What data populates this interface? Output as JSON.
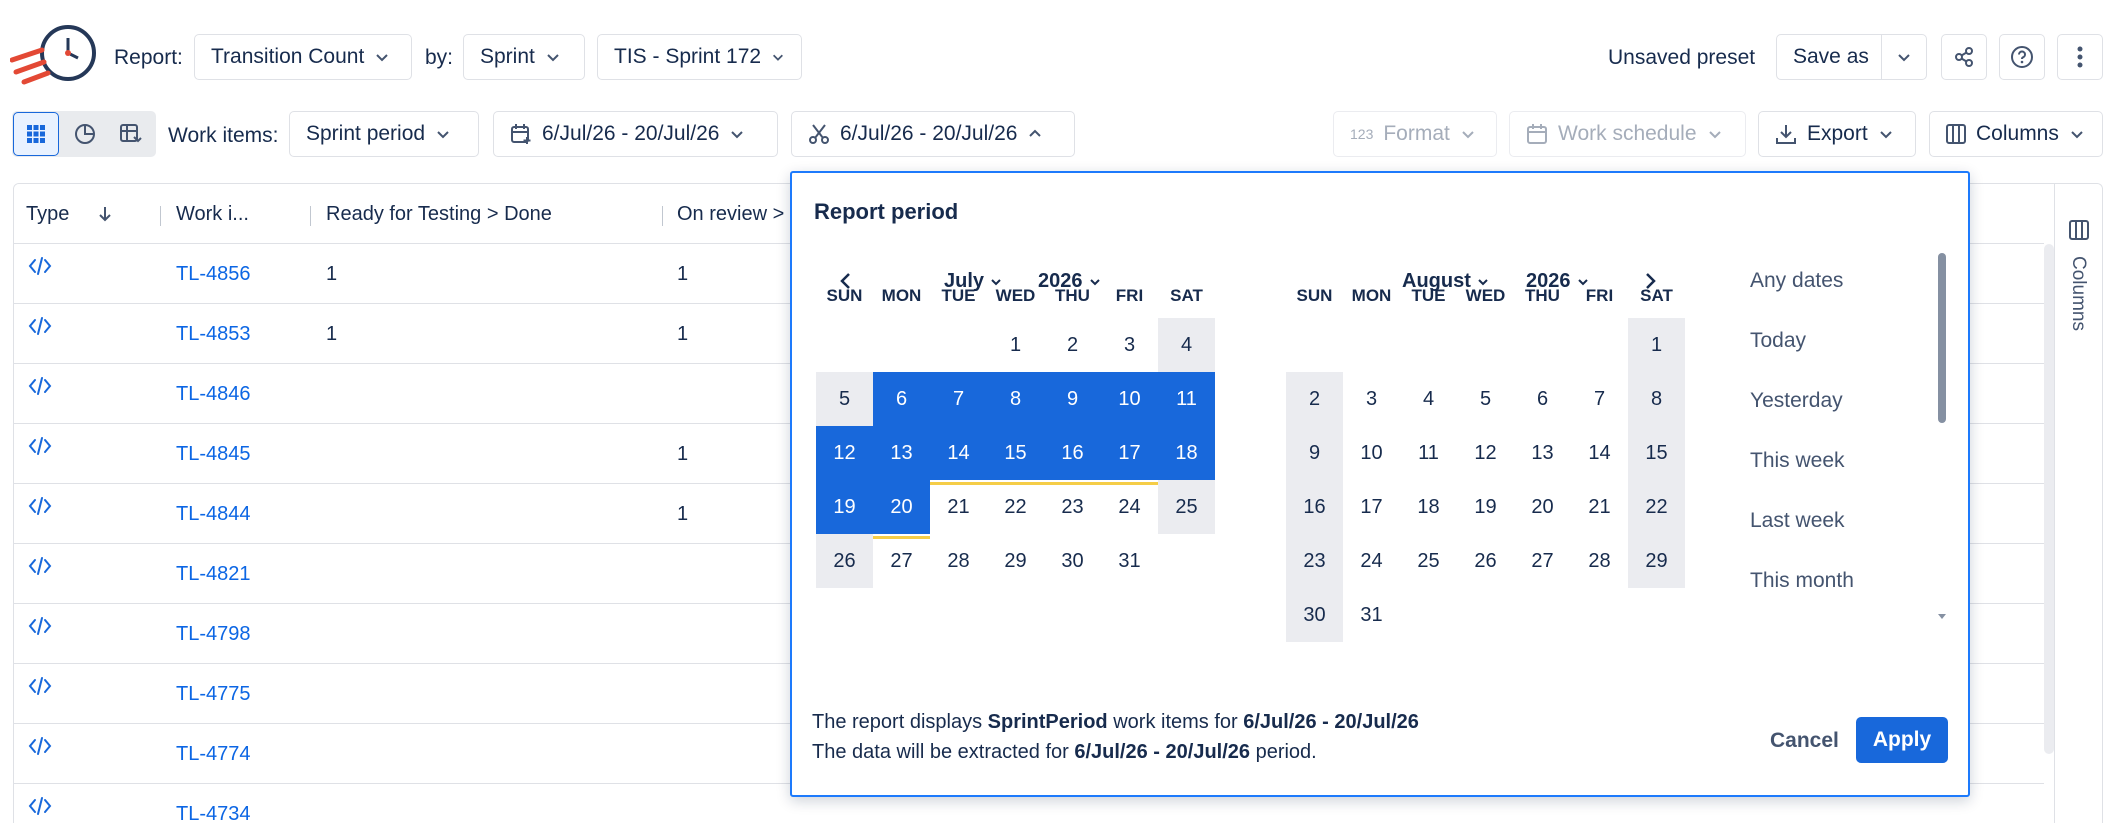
{
  "toolbar1": {
    "report_label": "Report:",
    "report_value": "Transition Count",
    "by_label": "by:",
    "by_value": "Sprint",
    "sprint_value": "TIS - Sprint 172",
    "preset_status": "Unsaved preset",
    "save_as": "Save as"
  },
  "toolbar2": {
    "work_items_label": "Work items:",
    "work_items_value": "Sprint period",
    "date_range_1": "6/Jul/26 - 20/Jul/26",
    "date_range_2": "6/Jul/26 - 20/Jul/26",
    "format": "Format",
    "format_prefix": "123",
    "work_schedule": "Work schedule",
    "export": "Export",
    "columns": "Columns"
  },
  "table": {
    "headers": [
      "Type",
      "Work i...",
      "Ready for Testing > Done",
      "On review >"
    ],
    "rows": [
      {
        "key": "TL-4856",
        "c1": "1",
        "c2": "1"
      },
      {
        "key": "TL-4853",
        "c1": "1",
        "c2": "1"
      },
      {
        "key": "TL-4846",
        "c1": "",
        "c2": ""
      },
      {
        "key": "TL-4845",
        "c1": "",
        "c2": "1"
      },
      {
        "key": "TL-4844",
        "c1": "",
        "c2": "1"
      },
      {
        "key": "TL-4821",
        "c1": "",
        "c2": ""
      },
      {
        "key": "TL-4798",
        "c1": "",
        "c2": ""
      },
      {
        "key": "TL-4775",
        "c1": "",
        "c2": ""
      },
      {
        "key": "TL-4774",
        "c1": "",
        "c2": ""
      },
      {
        "key": "TL-4734",
        "c1": "",
        "c2": ""
      }
    ],
    "side_panel_label": "Columns"
  },
  "popup": {
    "title": "Report period",
    "left_month": "July",
    "left_year": "2026",
    "right_month": "August",
    "right_year": "2026",
    "weekdays": [
      "SUN",
      "MON",
      "TUE",
      "WED",
      "THU",
      "FRI",
      "SAT"
    ],
    "july_days": [
      "1",
      "2",
      "3",
      "4",
      "5",
      "6",
      "7",
      "8",
      "9",
      "10",
      "11",
      "12",
      "13",
      "14",
      "15",
      "16",
      "17",
      "18",
      "19",
      "20",
      "21",
      "22",
      "23",
      "24",
      "25",
      "26",
      "27",
      "28",
      "29",
      "30",
      "31"
    ],
    "august_days": [
      "1",
      "2",
      "3",
      "4",
      "5",
      "6",
      "7",
      "8",
      "9",
      "10",
      "11",
      "12",
      "13",
      "14",
      "15",
      "16",
      "17",
      "18",
      "19",
      "20",
      "21",
      "22",
      "23",
      "24",
      "25",
      "26",
      "27",
      "28",
      "29",
      "30",
      "31"
    ],
    "quick_ranges": [
      "Any dates",
      "Today",
      "Yesterday",
      "This week",
      "Last week",
      "This month"
    ],
    "footer_line1_a": "The report displays ",
    "footer_line1_b": "SprintPeriod",
    "footer_line1_c": " work items for ",
    "footer_line1_d": "6/Jul/26 - 20/Jul/26",
    "footer_line2_a": "The data will be extracted for ",
    "footer_line2_b": "6/Jul/26 - 20/Jul/26",
    "footer_line2_c": " period.",
    "cancel": "Cancel",
    "apply": "Apply"
  }
}
